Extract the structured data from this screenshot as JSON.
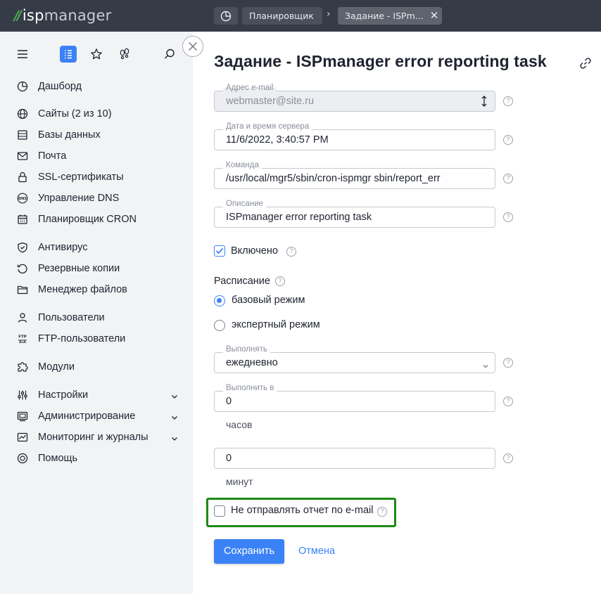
{
  "app": {
    "logo": "ispmanager",
    "logo_prefix": "isp",
    "logo_suffix": "manager"
  },
  "breadcrumbs": [
    {
      "label": "Планировщик"
    },
    {
      "label": "Задание - ISPman..."
    }
  ],
  "sidebar": {
    "items": [
      {
        "label": "Дашборд",
        "icon": "dashboard-icon"
      },
      {
        "label": "Сайты (2 из 10)",
        "icon": "globe-icon"
      },
      {
        "label": "Базы данных",
        "icon": "database-icon"
      },
      {
        "label": "Почта",
        "icon": "mail-icon"
      },
      {
        "label": "SSL-сертификаты",
        "icon": "lock-icon"
      },
      {
        "label": "Управление DNS",
        "icon": "dns-icon"
      },
      {
        "label": "Планировщик CRON",
        "icon": "calendar-icon"
      },
      {
        "label": "Антивирус",
        "icon": "shield-icon"
      },
      {
        "label": "Резервные копии",
        "icon": "backup-icon"
      },
      {
        "label": "Менеджер файлов",
        "icon": "folder-icon"
      },
      {
        "label": "Пользователи",
        "icon": "user-icon"
      },
      {
        "label": "FTP-пользователи",
        "icon": "ftp-icon"
      },
      {
        "label": "Модули",
        "icon": "puzzle-icon"
      },
      {
        "label": "Настройки",
        "icon": "sliders-icon"
      },
      {
        "label": "Администрирование",
        "icon": "server-icon"
      },
      {
        "label": "Мониторинг и журналы",
        "icon": "chart-icon"
      },
      {
        "label": "Помощь",
        "icon": "lifebuoy-icon"
      }
    ]
  },
  "form": {
    "title": "Задание - ISPmanager error reporting task",
    "email": {
      "label": "Адрес e-mail",
      "value": "webmaster@site.ru"
    },
    "server_time": {
      "label": "Дата и время сервера",
      "value": "11/6/2022, 3:40:57 PM"
    },
    "command": {
      "label": "Команда",
      "value": "/usr/local/mgr5/sbin/cron-ispmgr sbin/report_err"
    },
    "description": {
      "label": "Описание",
      "value": "ISPmanager error reporting task"
    },
    "enabled": {
      "label": "Включено",
      "checked": true
    },
    "schedule": {
      "label": "Расписание",
      "options": [
        {
          "label": "базовый режим",
          "selected": true
        },
        {
          "label": "экспертный режим",
          "selected": false
        }
      ]
    },
    "run": {
      "label": "Выполнять",
      "value": "ежедневно"
    },
    "run_at": {
      "label": "Выполнить в",
      "hours_value": "0",
      "hours_unit": "часов",
      "minutes_value": "0",
      "minutes_unit": "минут"
    },
    "no_email_report": {
      "label": "Не отправлять отчет по e-mail",
      "checked": false
    },
    "help_glyph": "?",
    "save_label": "Сохранить",
    "cancel_label": "Отмена"
  },
  "colors": {
    "accent": "#3b82f6",
    "topbar": "#363b48",
    "sidebar": "#f2f3f5",
    "highlight": "#1e8a17"
  }
}
